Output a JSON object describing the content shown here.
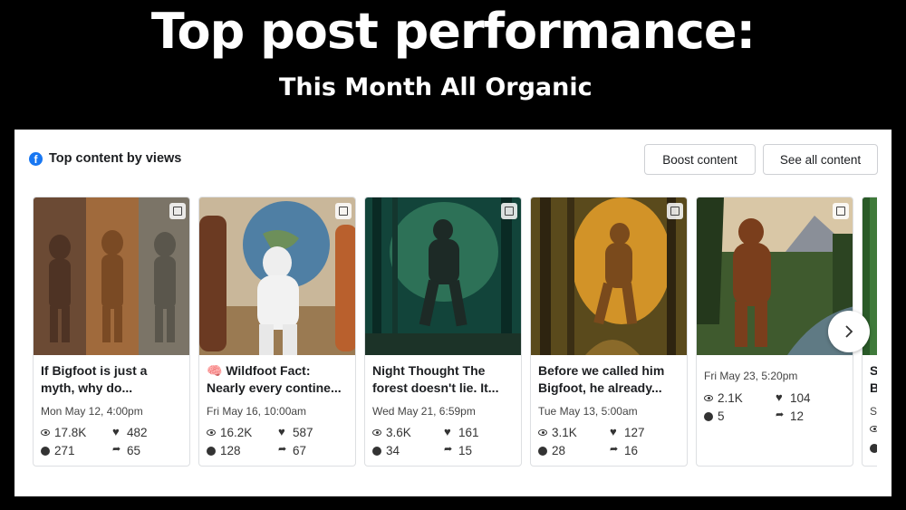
{
  "header": {
    "title": "Top post performance:",
    "subtitle": "This Month All Organic"
  },
  "section": {
    "title": "Top content by views",
    "icon": "facebook-icon"
  },
  "buttons": {
    "boost": "Boost content",
    "see_all": "See all content",
    "next": "chevron-right-icon"
  },
  "cards": [
    {
      "caption": "If Bigfoot is just a\nmyth, why do...",
      "date": "Mon May 12, 4:00pm",
      "views": "17.8K",
      "reactions": "482",
      "comments": "271",
      "shares": "65"
    },
    {
      "caption": "🧠 Wildfoot Fact:\nNearly every contine...",
      "date": "Fri May 16, 10:00am",
      "views": "16.2K",
      "reactions": "587",
      "comments": "128",
      "shares": "67"
    },
    {
      "caption": "Night Thought The\nforest doesn't lie. It...",
      "date": "Wed May 21, 6:59pm",
      "views": "3.6K",
      "reactions": "161",
      "comments": "34",
      "shares": "15"
    },
    {
      "caption": "Before we called him\nBigfoot, he already...",
      "date": "Tue May 13, 5:00am",
      "views": "3.1K",
      "reactions": "127",
      "comments": "28",
      "shares": "16"
    },
    {
      "caption": "",
      "date": "Fri May 23, 5:20pm",
      "views": "2.1K",
      "reactions": "104",
      "comments": "5",
      "shares": "12"
    },
    {
      "caption": "St\nB",
      "date": "Sa",
      "views": "",
      "reactions": "",
      "comments": "",
      "shares": ""
    }
  ],
  "colors": {
    "brand_blue": "#1877f2",
    "background": "#000000",
    "panel": "#ffffff"
  }
}
